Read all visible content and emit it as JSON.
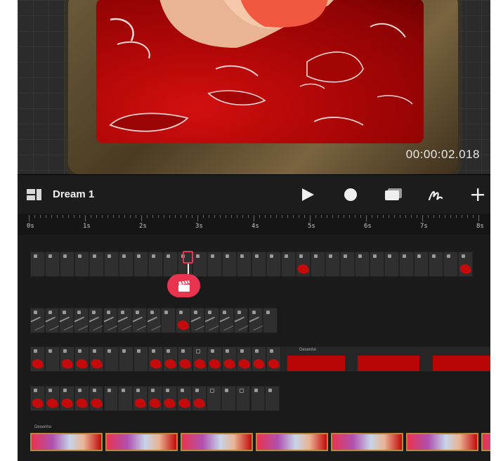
{
  "timecode": "00:00:02.018",
  "toolbar": {
    "title": "Dream 1",
    "buttons": [
      {
        "name": "play-button",
        "icon": "play-icon"
      },
      {
        "name": "record-button",
        "icon": "record-icon"
      },
      {
        "name": "canvas-button",
        "icon": "canvas-icon"
      },
      {
        "name": "brush-button",
        "icon": "brush-icon"
      },
      {
        "name": "add-button",
        "icon": "plus-icon"
      }
    ]
  },
  "ruler": {
    "labels": [
      "0s",
      "1s",
      "2s",
      "3s",
      "4s",
      "5s",
      "6s",
      "7s",
      "8s"
    ]
  },
  "tracks": [
    {
      "name": "frames-track-1",
      "frames": 30,
      "segment_label": ""
    },
    {
      "name": "frames-track-2",
      "frames": 17,
      "segment_label": ""
    },
    {
      "name": "frames-track-3",
      "frames": 17,
      "segment_label": "Desenho"
    },
    {
      "name": "frames-track-4",
      "frames": 17,
      "segment_label": ""
    },
    {
      "name": "video-track",
      "frames": 6,
      "segment_label": "Desenho"
    }
  ],
  "colors": {
    "accent": "#e8344f",
    "background": "#1a1a1a",
    "paint": "#c40a0a"
  }
}
